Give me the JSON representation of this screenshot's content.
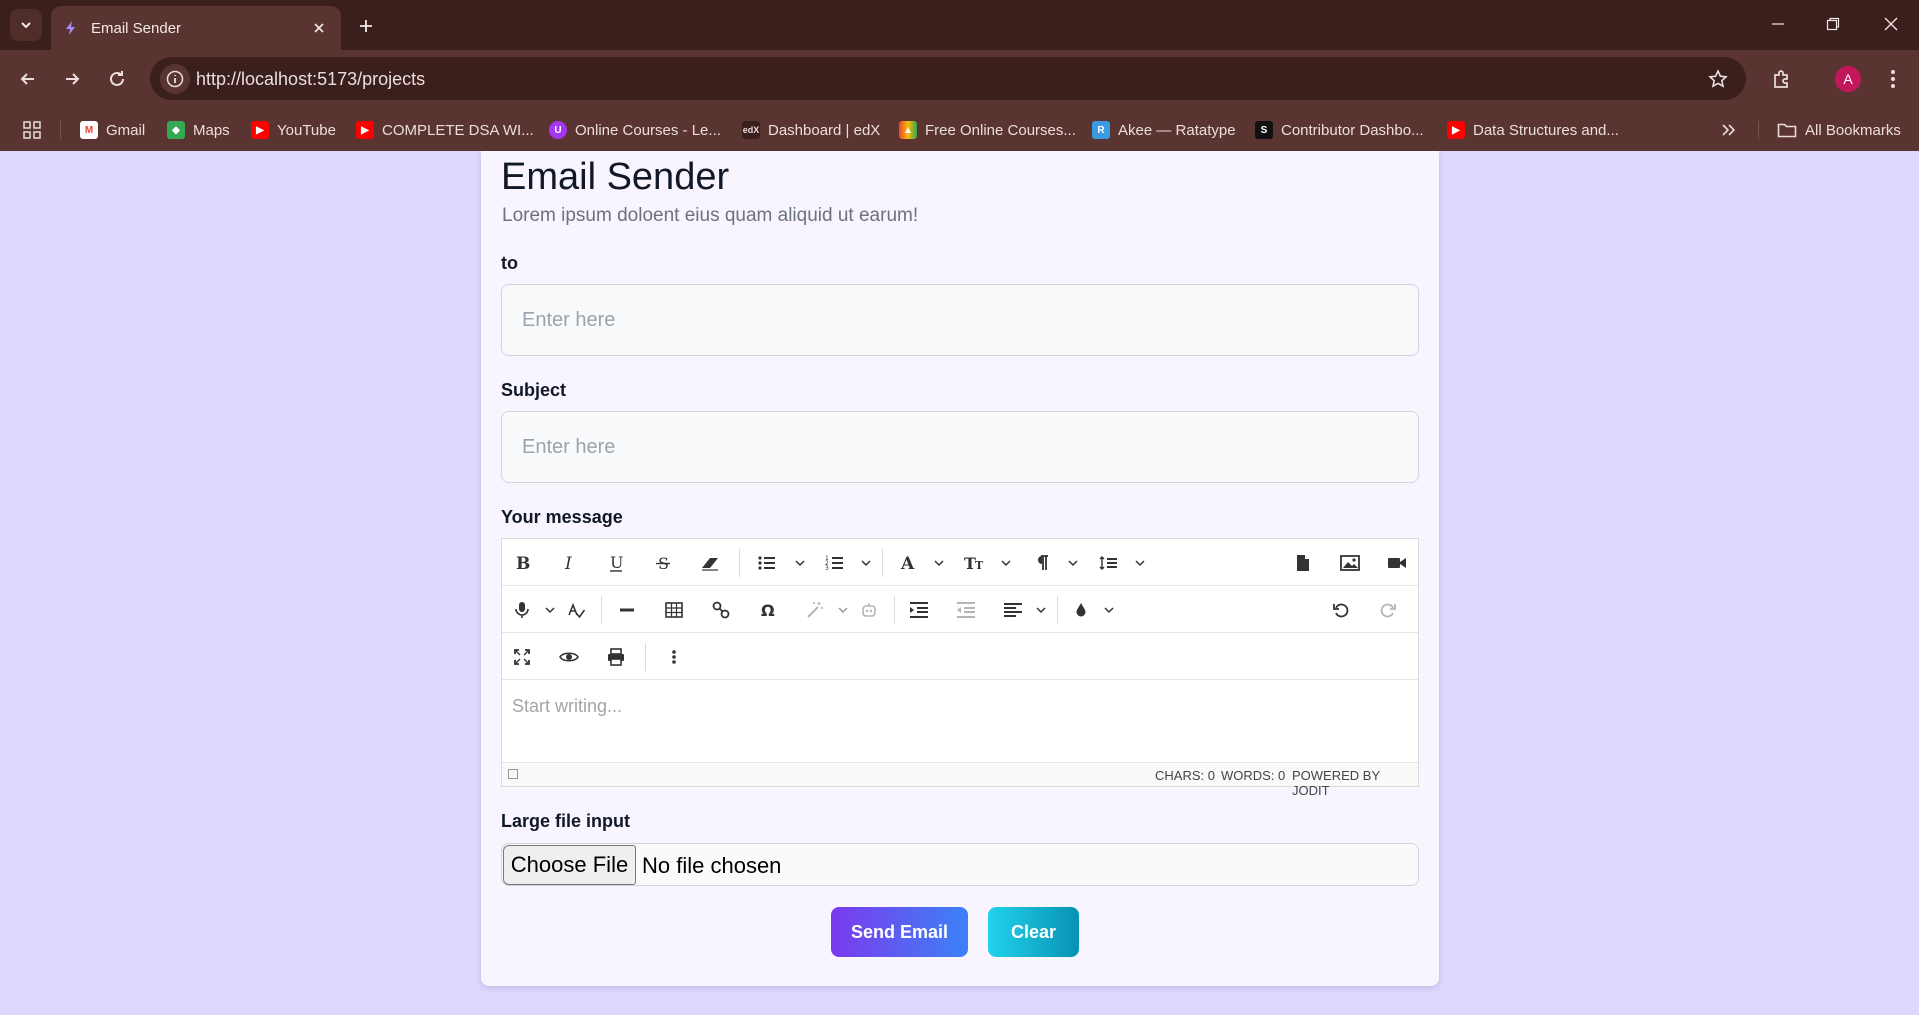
{
  "browser": {
    "tab_title": "Email Sender",
    "url": "http://localhost:5173/projects",
    "profile_initial": "A",
    "bookmarks": [
      {
        "label": "Gmail",
        "icon": "gmail-icon"
      },
      {
        "label": "Maps",
        "icon": "maps-icon"
      },
      {
        "label": "YouTube",
        "icon": "youtube-icon"
      },
      {
        "label": "COMPLETE DSA WI...",
        "icon": "youtube-icon"
      },
      {
        "label": "Online Courses - Le...",
        "icon": "udemy-icon"
      },
      {
        "label": "Dashboard | edX",
        "icon": "edx-icon"
      },
      {
        "label": "Free Online Courses...",
        "icon": "courses-icon"
      },
      {
        "label": "Akee — Ratatype",
        "icon": "ratatype-icon"
      },
      {
        "label": "Contributor Dashbo...",
        "icon": "contributor-icon"
      },
      {
        "label": "Data Structures and...",
        "icon": "youtube-icon"
      }
    ],
    "all_bookmarks_label": "All Bookmarks"
  },
  "page": {
    "title": "Email Sender",
    "subtitle": "Lorem ipsum doloent eius quam aliquid ut earum!",
    "to_label": "to",
    "to_placeholder": "Enter here",
    "subject_label": "Subject",
    "subject_placeholder": "Enter here",
    "message_label": "Your message",
    "editor": {
      "placeholder": "Start writing...",
      "chars": "CHARS: 0",
      "words": "WORDS: 0",
      "powered_by": "POWERED BY JODIT"
    },
    "file_label": "Large file input",
    "file_button": "Choose File",
    "file_status": "No file chosen",
    "send_button": "Send Email",
    "clear_button": "Clear"
  },
  "colors": {
    "page_background": "#ddd6fe",
    "card_background": "#f8f5ff",
    "send_gradient": [
      "#7c3aed",
      "#3b82f6"
    ],
    "clear_gradient": [
      "#22d3ee",
      "#0891b2"
    ],
    "browser_frame": "#3a1f1c"
  }
}
